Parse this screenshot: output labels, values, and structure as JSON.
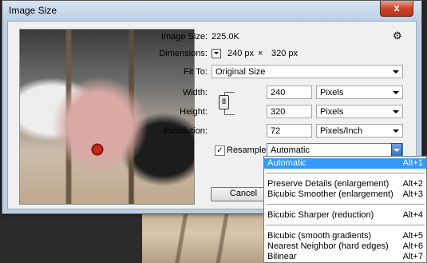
{
  "window": {
    "title": "Image Size",
    "close_label": "x"
  },
  "image_size": {
    "label": "Image Size:",
    "value": "225.0K"
  },
  "dimensions": {
    "label": "Dimensions:",
    "width": "240 px",
    "times": "×",
    "height": "320 px"
  },
  "fit_to": {
    "label": "Fit To:",
    "value": "Original Size"
  },
  "width": {
    "label": "Width:",
    "value": "240",
    "unit": "Pixels"
  },
  "height": {
    "label": "Height:",
    "value": "320",
    "unit": "Pixels"
  },
  "resolution": {
    "label": "Resolution:",
    "value": "72",
    "unit": "Pixels/Inch"
  },
  "resample": {
    "label": "Resample:",
    "checked": true,
    "check_mark": "✓",
    "value": "Automatic"
  },
  "buttons": {
    "cancel": "Cancel"
  },
  "menu": {
    "items": [
      {
        "label": "Automatic",
        "shortcut": "Alt+1"
      },
      {
        "label": "Preserve Details (enlargement)",
        "shortcut": "Alt+2"
      },
      {
        "label": "Bicubic Smoother (enlargement)",
        "shortcut": "Alt+3"
      },
      {
        "label": "Bicubic Sharper (reduction)",
        "shortcut": "Alt+4"
      },
      {
        "label": "Bicubic (smooth gradients)",
        "shortcut": "Alt+5"
      },
      {
        "label": "Nearest Neighbor (hard edges)",
        "shortcut": "Alt+6"
      },
      {
        "label": "Bilinear",
        "shortcut": "Alt+7"
      }
    ]
  },
  "colors": {
    "selection": "#3399ff",
    "dialog_frame": "#bcd0e5",
    "close": "#c9452a"
  }
}
